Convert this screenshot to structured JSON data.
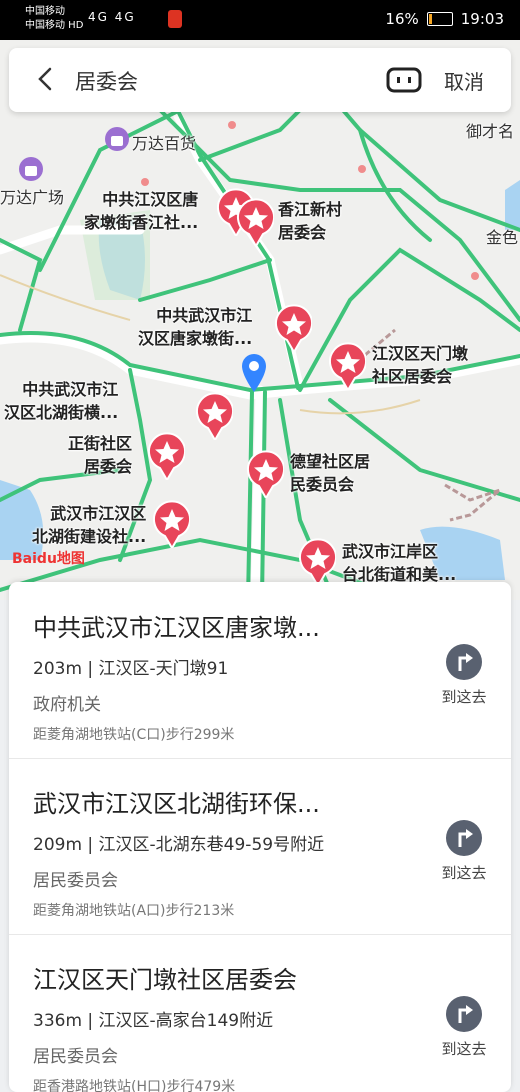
{
  "status": {
    "carrier1": "中国移动",
    "carrier2": "中国移动 HD",
    "signal": "4G 4G",
    "battery": "16%",
    "battery_level": 0.16,
    "time": "19:03"
  },
  "search": {
    "query": "居委会",
    "cancel_label": "取消"
  },
  "map": {
    "baidu_logo": "Baidu地图",
    "place_labels": [
      "万达百货",
      "万达广场",
      "御才名",
      "金色"
    ],
    "pois": [
      "中共江汉区唐\n家墩街香江社...",
      "香江新村\n居委会",
      "中共武汉市江\n汉区唐家墩街...",
      "江汉区天门墩\n社区居委会",
      "中共武汉市江\n汉区北湖街横...",
      "正街社区\n居委会",
      "德望社区居\n民委员会",
      "武汉市江汉区\n北湖街建设社...",
      "武汉市江岸区\n台北街道和美..."
    ]
  },
  "results": [
    {
      "title": "中共武汉市江汉区唐家墩...",
      "meta": "203m | 江汉区-天门墩91",
      "category": "政府机关",
      "sub": "距菱角湖地铁站(C口)步行299米",
      "go_label": "到这去"
    },
    {
      "title": "武汉市江汉区北湖街环保...",
      "meta": "209m | 江汉区-北湖东巷49-59号附近",
      "category": "居民委员会",
      "sub": "距菱角湖地铁站(A口)步行213米",
      "go_label": "到这去"
    },
    {
      "title": "江汉区天门墩社区居委会",
      "meta": "336m | 江汉区-高家台149附近",
      "category": "居民委员会",
      "sub": "距香港路地铁站(H口)步行479米",
      "go_label": "到这去"
    }
  ]
}
